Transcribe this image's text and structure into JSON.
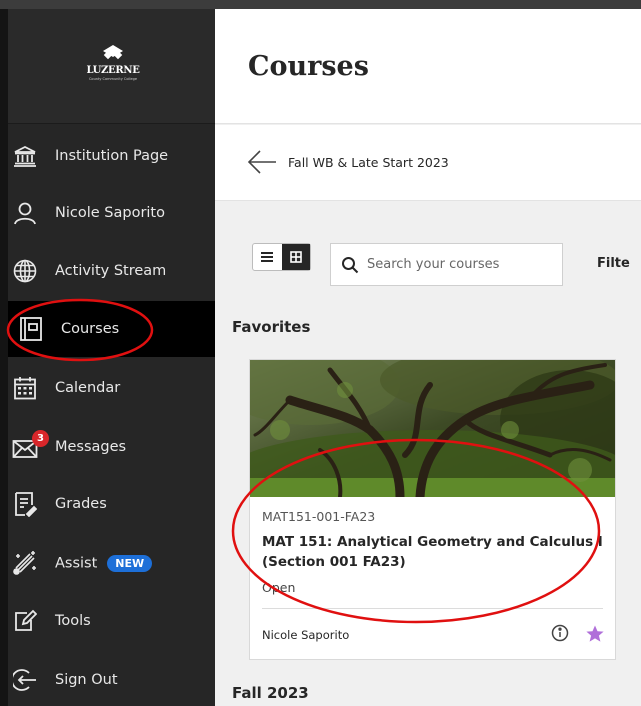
{
  "sidebar": {
    "logo": {
      "name": "LUZERNE",
      "subtitle": "County Community College"
    },
    "items": [
      {
        "label": "Institution Page",
        "icon": "institution-icon"
      },
      {
        "label": "Nicole Saporito",
        "icon": "person-icon"
      },
      {
        "label": "Activity Stream",
        "icon": "globe-icon"
      },
      {
        "label": "Courses",
        "icon": "courses-icon",
        "active": true
      },
      {
        "label": "Calendar",
        "icon": "calendar-icon"
      },
      {
        "label": "Messages",
        "icon": "envelope-icon",
        "badge": "3"
      },
      {
        "label": "Grades",
        "icon": "grades-icon"
      },
      {
        "label": "Assist",
        "icon": "assist-icon",
        "tag": "NEW"
      },
      {
        "label": "Tools",
        "icon": "tools-icon"
      },
      {
        "label": "Sign Out",
        "icon": "sign-out-icon"
      }
    ]
  },
  "header": {
    "title": "Courses"
  },
  "term": {
    "label": "Fall WB & Late Start 2023"
  },
  "toolbar": {
    "search_placeholder": "Search your courses",
    "filter_label": "Filte"
  },
  "sections": {
    "favorites": "Favorites",
    "fall": "Fall 2023"
  },
  "course_card": {
    "code": "MAT151-001-FA23",
    "title": "MAT 151: Analytical Geometry and Calculus I (Section 001 FA23)",
    "status": "Open",
    "instructor": "Nicole Saporito",
    "favorite_color": "#b06fd9"
  },
  "colors": {
    "sidebar_bg": "#262626",
    "active_bg": "#000000",
    "annotation_red": "#e01010",
    "new_badge": "#1d6fd8",
    "message_badge": "#d8262a"
  }
}
